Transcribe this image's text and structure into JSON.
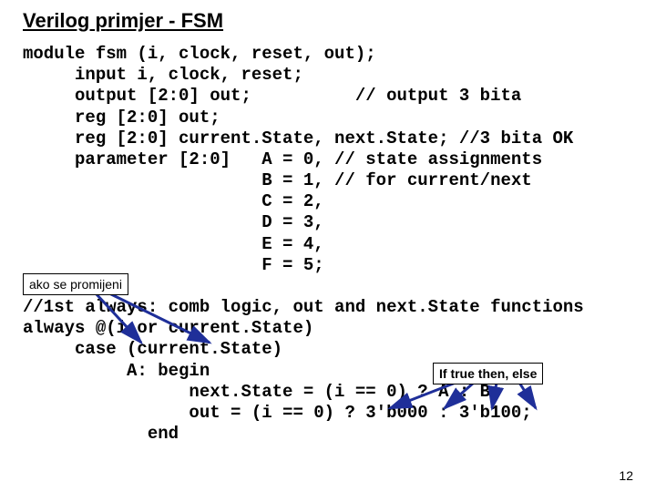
{
  "title": "Verilog primjer - FSM",
  "code_lines": [
    "module fsm (i, clock, reset, out);",
    "     input i, clock, reset;",
    "     output [2:0] out;          // output 3 bita",
    "     reg [2:0] out;",
    "     reg [2:0] current.State, next.State; //3 bita OK",
    "     parameter [2:0]   A = 0, // state assignments",
    "                       B = 1, // for current/next",
    "                       C = 2,",
    "                       D = 3,",
    "                       E = 4,",
    "                       F = 5;",
    "",
    "//1st always: comb logic, out and next.State functions",
    "always @(i or current.State)",
    "     case (current.State)",
    "          A: begin",
    "                next.State = (i == 0) ? A : B;",
    "                out = (i == 0) ? 3'b000 : 3'b100;",
    "            end"
  ],
  "callout_left": "ako se promijeni",
  "callout_right": "If true then, else",
  "page_number": "12"
}
